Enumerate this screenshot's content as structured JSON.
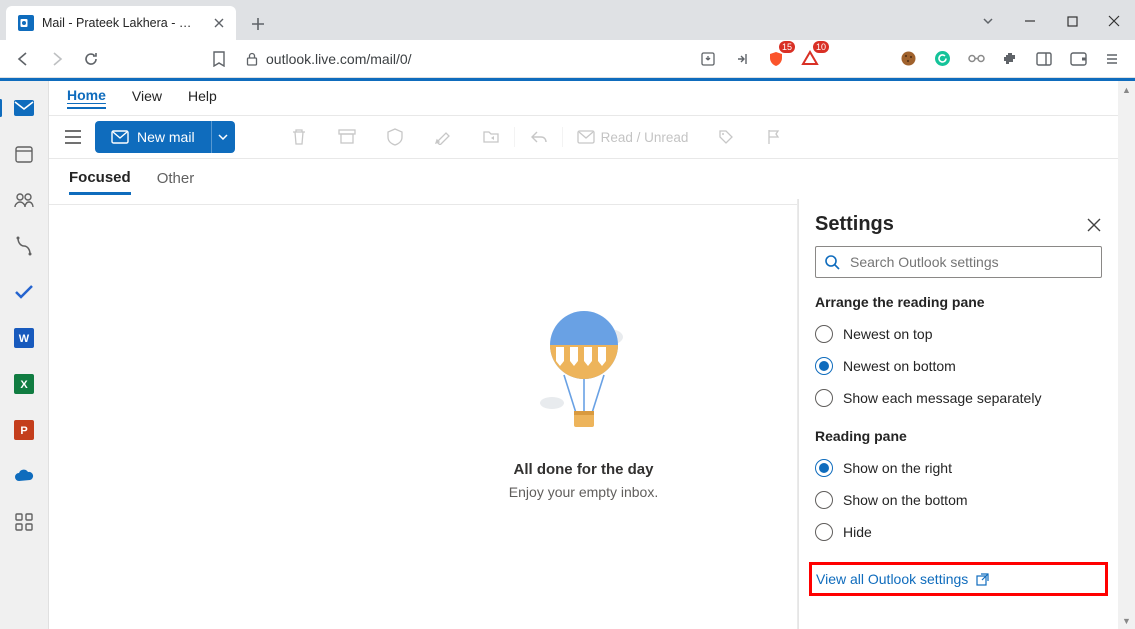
{
  "browser": {
    "tab_title": "Mail - Prateek Lakhera - Outlook",
    "url": "outlook.live.com/mail/0/",
    "ext_brave_count": "15",
    "ext_ab_count": "10"
  },
  "leftrail": {
    "items": [
      "mail",
      "calendar",
      "people",
      "files",
      "todo",
      "word",
      "excel",
      "powerpoint",
      "onedrive",
      "apps"
    ]
  },
  "menubar": {
    "home": "Home",
    "view": "View",
    "help": "Help"
  },
  "toolbar": {
    "new_mail": "New mail",
    "read_unread": "Read / Unread"
  },
  "tabs": {
    "focused": "Focused",
    "other": "Other"
  },
  "empty": {
    "title": "All done for the day",
    "subtitle": "Enjoy your empty inbox."
  },
  "settings": {
    "title": "Settings",
    "search_placeholder": "Search Outlook settings",
    "arrange_title": "Arrange the reading pane",
    "arrange_options": {
      "newest_top": "Newest on top",
      "newest_bottom": "Newest on bottom",
      "separate": "Show each message separately"
    },
    "reading_title": "Reading pane",
    "reading_options": {
      "right": "Show on the right",
      "bottom": "Show on the bottom",
      "hide": "Hide"
    },
    "view_all": "View all Outlook settings",
    "selected_arrange": "newest_bottom",
    "selected_reading": "right"
  }
}
